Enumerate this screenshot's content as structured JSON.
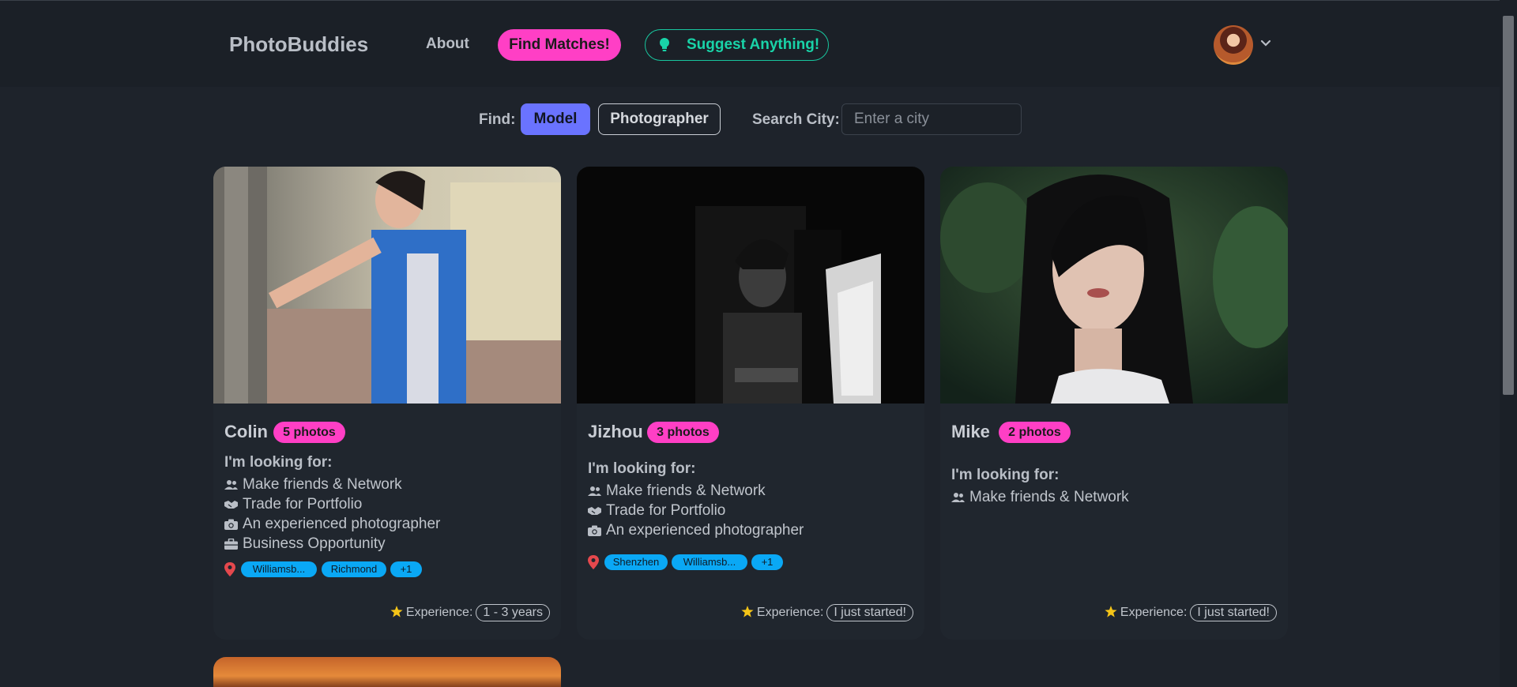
{
  "nav": {
    "brand": "PhotoBuddies",
    "about": "About",
    "find_matches": "Find Matches!",
    "suggest": "Suggest Anything!"
  },
  "filter": {
    "find_label": "Find:",
    "model": "Model",
    "photographer": "Photographer",
    "city_label": "Search City:",
    "city_placeholder": "Enter a city"
  },
  "cards": [
    {
      "name": "Colin",
      "photos": "5 photos",
      "looking_label": "I'm looking for:",
      "prefs": [
        "Make friends & Network",
        "Trade for Portfolio",
        "An experienced photographer",
        "Business Opportunity"
      ],
      "pref_icons": [
        "users-icon",
        "handshake-icon",
        "camera-icon",
        "briefcase-icon"
      ],
      "cities": [
        "Williamsb...",
        "Richmond",
        "+1"
      ],
      "exp_label": "Experience:",
      "experience": "1 - 3 years"
    },
    {
      "name": "Jizhou",
      "photos": "3 photos",
      "looking_label": "I'm looking for:",
      "prefs": [
        "Make friends & Network",
        "Trade for Portfolio",
        "An experienced photographer"
      ],
      "pref_icons": [
        "users-icon",
        "handshake-icon",
        "camera-icon"
      ],
      "cities": [
        "Shenzhen",
        "Williamsb...",
        "+1"
      ],
      "exp_label": "Experience:",
      "experience": "I just started!"
    },
    {
      "name": "Mike",
      "photos": "2 photos",
      "looking_label": "I'm looking for:",
      "prefs": [
        "Make friends & Network"
      ],
      "pref_icons": [
        "users-icon"
      ],
      "cities": [],
      "exp_label": "Experience:",
      "experience": "I just started!"
    }
  ],
  "colors": {
    "background": "#1e232b",
    "accent_pink": "#ff3fc5",
    "accent_teal": "#19d3a8",
    "accent_indigo": "#6a73ff",
    "tag_blue": "#0aa8f5",
    "star": "#f5c518",
    "pin": "#e5484d"
  }
}
